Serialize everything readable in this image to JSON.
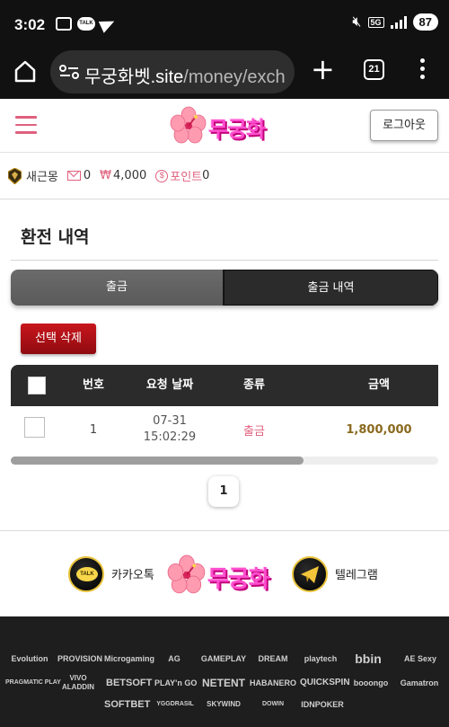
{
  "status_bar": {
    "time": "3:02",
    "talk_badge": "TALK",
    "network": "5G",
    "battery": "87"
  },
  "browser": {
    "url_host": "무궁화벳.site",
    "url_path": "/money/exch",
    "tab_count": "21"
  },
  "header": {
    "logo_text": "무궁화",
    "logout_label": "로그아웃"
  },
  "user": {
    "name": "새근몽",
    "messages": "0",
    "currency_symbol": "₩",
    "balance": "4,000",
    "points_icon": "$",
    "points_label": "포인트",
    "points": "0"
  },
  "page": {
    "title": "환전 내역",
    "tabs": [
      {
        "label": "출금"
      },
      {
        "label": "출금 내역"
      }
    ],
    "delete_label": "선택 삭제"
  },
  "table": {
    "columns": [
      "번호",
      "요청 날짜",
      "종류",
      "금액"
    ],
    "rows": [
      {
        "no": "1",
        "date": "07-31",
        "time": "15:02:29",
        "type": "출금",
        "amount": "1,800,000"
      }
    ]
  },
  "pagination": {
    "current": "1"
  },
  "contacts": {
    "kakao_label": "카카오톡",
    "kakao_badge": "TALK",
    "logo_text": "무궁화",
    "telegram_label": "텔레그램"
  },
  "partners": {
    "row1": [
      "Evolution",
      "PROVISION",
      "Microgaming",
      "AG",
      "GAMEPLAY",
      "DREAM",
      "playtech",
      "bbin",
      "AE Sexy"
    ],
    "row2": [
      "PRAGMATIC PLAY",
      "VIVO ALADDIN",
      "BETSOFT",
      "PLAY'n GO",
      "NETENT",
      "HABANERO",
      "QUICKSPIN",
      "booongo",
      "Gamatron"
    ],
    "row3": [
      "SOFTBET",
      "YGGDRASIL",
      "SKYWIND",
      "DOWIN",
      "IDNPOKER"
    ]
  },
  "colors": {
    "accent_pink": "#e0607e",
    "logo_pink": "#ff4fcf",
    "delete_red": "#b3121a",
    "amount_gold": "#8a6a1e",
    "dark": "#2b2b2b"
  }
}
